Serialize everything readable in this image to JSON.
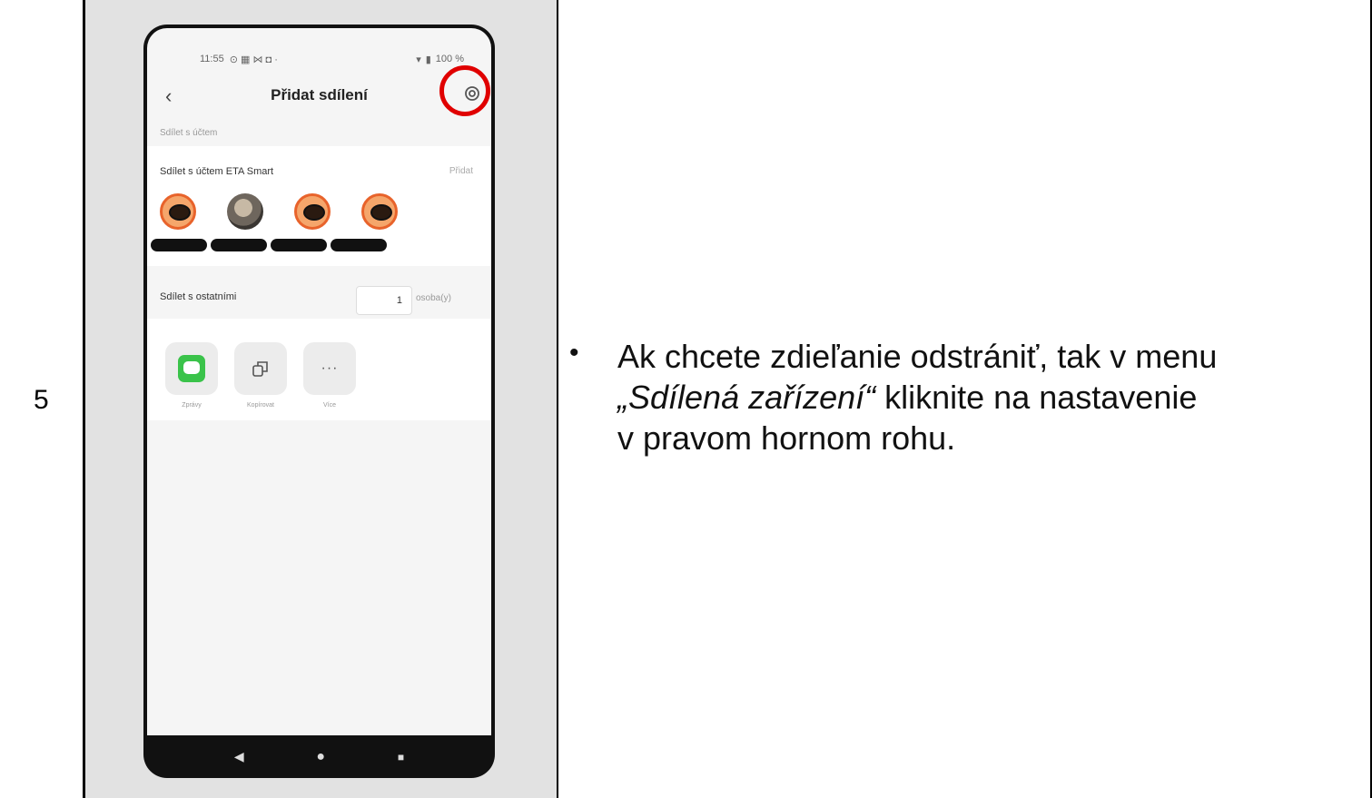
{
  "step": {
    "number": "5"
  },
  "phone": {
    "status": {
      "time": "11:55",
      "battery": "100 %"
    },
    "header": {
      "title": "Přidat sdílení"
    },
    "section_account_label": "Sdílet s účtem",
    "account_card": {
      "title": "Sdílet s účtem ETA Smart",
      "action": "Přidat"
    },
    "others": {
      "label": "Sdílet s ostatními",
      "count": "1",
      "unit": "osoba(y)"
    },
    "share_options": [
      {
        "label": "Zprávy",
        "icon": "message-icon"
      },
      {
        "label": "Kopírovat",
        "icon": "copy-icon"
      },
      {
        "label": "Více",
        "icon": "more-icon"
      }
    ]
  },
  "instruction": {
    "bullet": "•",
    "line1": "Ak chcete zdieľanie odstrániť, tak v menu",
    "line2_italic": "„Sdílená zařízení“",
    "line2_rest": " kliknite na nastavenie",
    "line3": "v pravom hornom rohu."
  },
  "colors": {
    "highlight": "#e00000",
    "camera_orange": "#e8632b",
    "message_green": "#3ac34a"
  }
}
